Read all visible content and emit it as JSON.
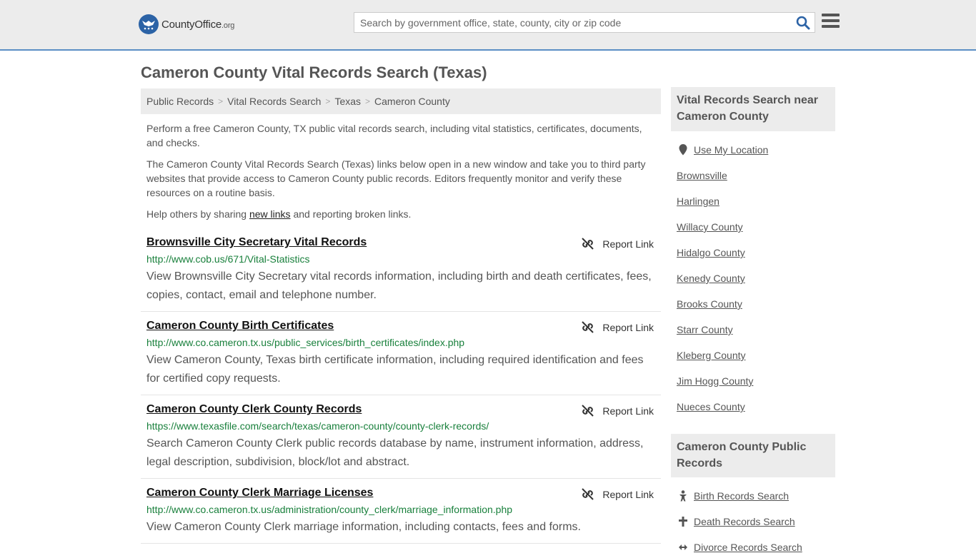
{
  "header": {
    "logo_text": "CountyOffice",
    "logo_tld": ".org",
    "search_placeholder": "Search by government office, state, county, city or zip code"
  },
  "page_title": "Cameron County Vital Records Search (Texas)",
  "breadcrumb": [
    "Public Records",
    "Vital Records Search",
    "Texas",
    "Cameron County"
  ],
  "intro": {
    "p1": "Perform a free Cameron County, TX public vital records search, including vital statistics, certificates, documents, and checks.",
    "p2": "The Cameron County Vital Records Search (Texas) links below open in a new window and take you to third party websites that provide access to Cameron County public records. Editors frequently monitor and verify these resources on a routine basis.",
    "p3_before": "Help others by sharing ",
    "p3_link": "new links",
    "p3_after": " and reporting broken links."
  },
  "report_label": "Report Link",
  "results": [
    {
      "title": "Brownsville City Secretary Vital Records",
      "url": "http://www.cob.us/671/Vital-Statistics",
      "desc": "View Brownsville City Secretary vital records information, including birth and death certificates, fees, copies, contact, email and telephone number."
    },
    {
      "title": "Cameron County Birth Certificates",
      "url": "http://www.co.cameron.tx.us/public_services/birth_certificates/index.php",
      "desc": "View Cameron County, Texas birth certificate information, including required identification and fees for certified copy requests."
    },
    {
      "title": "Cameron County Clerk County Records",
      "url": "https://www.texasfile.com/search/texas/cameron-county/county-clerk-records/",
      "desc": "Search Cameron County Clerk public records database by name, instrument information, address, legal description, subdivision, block/lot and abstract."
    },
    {
      "title": "Cameron County Clerk Marriage Licenses",
      "url": "http://www.co.cameron.tx.us/administration/county_clerk/marriage_information.php",
      "desc": "View Cameron County Clerk marriage information, including contacts, fees and forms."
    }
  ],
  "sidebar": {
    "nearby_heading": "Vital Records Search near Cameron County",
    "use_location": "Use My Location",
    "nearby": [
      "Brownsville",
      "Harlingen",
      "Willacy County",
      "Hidalgo County",
      "Kenedy County",
      "Brooks County",
      "Starr County",
      "Kleberg County",
      "Jim Hogg County",
      "Nueces County"
    ],
    "public_heading": "Cameron County Public Records",
    "public_links": [
      "Birth Records Search",
      "Death Records Search",
      "Divorce Records Search"
    ]
  }
}
